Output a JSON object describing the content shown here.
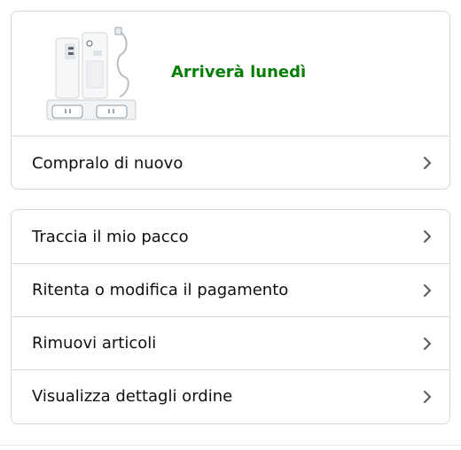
{
  "shipment": {
    "delivery_status": "Arriverà lunedì",
    "status_color": "#067d06",
    "product_image_icon": "charging-dock-product-icon",
    "buy_again_label": "Compralo di nuovo"
  },
  "actions": {
    "items": [
      {
        "label": "Traccia il mio pacco"
      },
      {
        "label": "Ritenta o modifica il pagamento"
      },
      {
        "label": "Rimuovi articoli"
      },
      {
        "label": "Visualizza dettagli ordine"
      }
    ]
  },
  "icons": {
    "chevron": "chevron-right-icon"
  },
  "colors": {
    "border": "#d5d9d9",
    "text": "#0f1111",
    "chevron": "#565959"
  }
}
